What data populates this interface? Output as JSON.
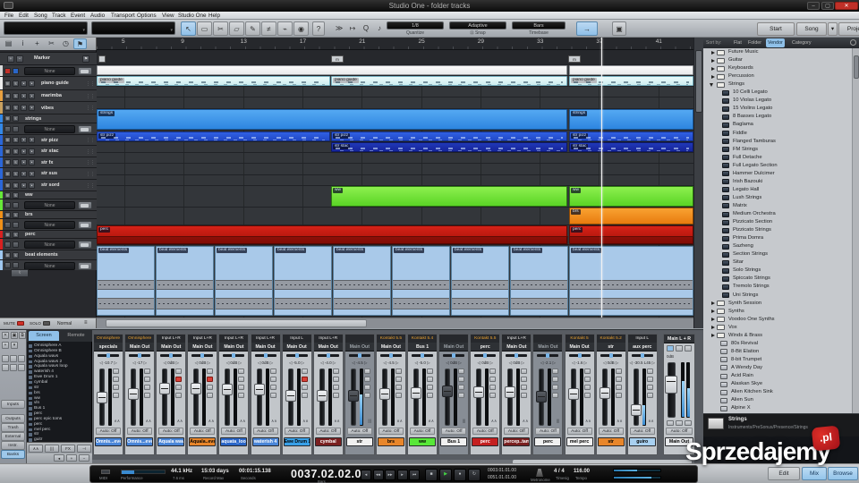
{
  "window": {
    "title": "Studio One - folder tracks"
  },
  "menu": [
    "File",
    "Edit",
    "Song",
    "Track",
    "Event",
    "Audio",
    "Transport",
    "Options",
    "View",
    "Studio One",
    "Help"
  ],
  "toolbar": {
    "help": "?",
    "quantize": {
      "value": "1/8",
      "label": "Quantize"
    },
    "snap": {
      "value": "Adaptive",
      "label": "Snap"
    },
    "timebase": {
      "value": "Bars",
      "label": "Timebase"
    },
    "start": "Start",
    "song": "Song",
    "project": "Project"
  },
  "ruler": {
    "bars": [
      "5",
      "9",
      "13",
      "17",
      "21",
      "25",
      "29",
      "33",
      "37",
      "41"
    ]
  },
  "tracklist": {
    "marker_name": "Marker",
    "bus_none": "None",
    "rows": [
      {
        "type": "group",
        "name": "",
        "color": "#d8d8d8"
      },
      {
        "type": "track",
        "name": "piano guide",
        "color": "#ececec"
      },
      {
        "type": "track",
        "name": "marimba",
        "color": "#e8a040"
      },
      {
        "type": "track",
        "name": "vibes",
        "color": "#c8a060"
      },
      {
        "type": "hdr",
        "name": "strings",
        "color": "#3388e8"
      },
      {
        "type": "none",
        "name": "",
        "color": "#3388e8"
      },
      {
        "type": "track",
        "name": "str pizz",
        "color": "#2a66d8"
      },
      {
        "type": "track",
        "name": "str stac",
        "color": "#2a66d8"
      },
      {
        "type": "track",
        "name": "str fx",
        "color": "#2a66d8"
      },
      {
        "type": "track",
        "name": "str sus",
        "color": "#2a66d8"
      },
      {
        "type": "track",
        "name": "str sord",
        "color": "#2a66d8"
      },
      {
        "type": "hdr",
        "name": "ww",
        "color": "#66e838"
      },
      {
        "type": "none",
        "name": "",
        "color": "#66e838"
      },
      {
        "type": "hdr",
        "name": "brs",
        "color": "#f09018"
      },
      {
        "type": "none",
        "name": "",
        "color": "#f09018"
      },
      {
        "type": "hdr",
        "name": "perc",
        "color": "#d82020"
      },
      {
        "type": "none",
        "name": "",
        "color": "#d82020"
      },
      {
        "type": "hdr",
        "name": "beat elements",
        "color": "#a0c8f0"
      },
      {
        "type": "none",
        "name": "",
        "color": "#a0c8f0"
      }
    ],
    "bottom": {
      "mute": "MUTE",
      "solo": "SOLO",
      "mode": "Normal"
    }
  },
  "arrange": {
    "markers": [
      {
        "label": "",
        "pos": 2
      },
      {
        "label": "m",
        "pos": 262
      },
      {
        "label": "m",
        "pos": 527
      }
    ],
    "rows": [
      {
        "track": "folder overview",
        "clips": [
          {
            "pos": 0,
            "len": 526,
            "color": "white"
          },
          {
            "pos": 528,
            "len": 139,
            "color": "white"
          }
        ]
      },
      {
        "track": "piano guide",
        "clips": [
          {
            "pos": 0,
            "len": 261,
            "color": "cyan",
            "label": "piano guide",
            "notes": true
          },
          {
            "pos": 262,
            "len": 264,
            "color": "cyan",
            "label": "piano guide",
            "notes": true
          },
          {
            "pos": 528,
            "len": 139,
            "color": "cyan",
            "label": "piano guide",
            "notes": true
          }
        ]
      },
      {
        "track": "marimba",
        "clips": []
      },
      {
        "track": "vibes",
        "clips": []
      },
      {
        "track": "strings",
        "clips": [
          {
            "pos": 0,
            "len": 526,
            "color": "blue",
            "label": "strings"
          },
          {
            "pos": 528,
            "len": 139,
            "color": "blue",
            "label": "strings"
          }
        ]
      },
      {
        "track": "str pizz",
        "clips": [
          {
            "pos": 0,
            "len": 261,
            "color": "mblue",
            "label": "str pizz",
            "notes": true
          },
          {
            "pos": 262,
            "len": 264,
            "color": "mblue",
            "label": "str pizz",
            "notes": true
          },
          {
            "pos": 528,
            "len": 139,
            "color": "mblue",
            "label": "str pizz",
            "notes": true
          }
        ]
      },
      {
        "track": "str stac",
        "clips": [
          {
            "pos": 262,
            "len": 264,
            "color": "dblue",
            "label": "str stac",
            "notes": true
          },
          {
            "pos": 528,
            "len": 139,
            "color": "dblue",
            "label": "str stac",
            "notes": true
          }
        ]
      },
      {
        "track": "str fx",
        "clips": []
      },
      {
        "track": "str sus",
        "clips": []
      },
      {
        "track": "str sord",
        "clips": []
      },
      {
        "track": "ww",
        "clips": [
          {
            "pos": 262,
            "len": 264,
            "color": "green",
            "label": "ww"
          },
          {
            "pos": 528,
            "len": 139,
            "color": "green",
            "label": "ww"
          }
        ]
      },
      {
        "track": "brs",
        "clips": [
          {
            "pos": 528,
            "len": 139,
            "color": "orange",
            "label": "brs"
          }
        ]
      },
      {
        "track": "perc",
        "clips": [
          {
            "pos": 0,
            "len": 526,
            "color": "red",
            "label": "perc"
          },
          {
            "pos": 528,
            "len": 139,
            "color": "red",
            "label": "perc"
          }
        ]
      },
      {
        "track": "beat elements",
        "beat": true,
        "clips": [
          {
            "pos": 0,
            "len": 65,
            "color": "beat",
            "label": "beat elements"
          },
          {
            "pos": 66,
            "len": 65,
            "color": "beat",
            "label": "beat elements"
          },
          {
            "pos": 132,
            "len": 65,
            "color": "beat",
            "label": "beat elements"
          },
          {
            "pos": 198,
            "len": 65,
            "color": "beat",
            "label": "beat elements"
          },
          {
            "pos": 264,
            "len": 65,
            "color": "beat",
            "label": "beat elements"
          },
          {
            "pos": 330,
            "len": 65,
            "color": "beat",
            "label": "beat elements"
          },
          {
            "pos": 396,
            "len": 65,
            "color": "beat",
            "label": "beat elements"
          },
          {
            "pos": 462,
            "len": 65,
            "color": "beat",
            "label": "beat elements"
          },
          {
            "pos": 528,
            "len": 139,
            "color": "beat",
            "label": "beat elements"
          }
        ]
      }
    ]
  },
  "browser": {
    "sort_by": "Sort by:",
    "tabs": [
      "Flat",
      "Folder",
      "Vendor",
      "Category"
    ],
    "active_tab": "Vendor",
    "items": [
      {
        "kind": "folder",
        "label": "Future Music"
      },
      {
        "kind": "folder",
        "label": "Guitar"
      },
      {
        "kind": "folder",
        "label": "Keyboards"
      },
      {
        "kind": "folder",
        "label": "Percussion"
      },
      {
        "kind": "folder-open",
        "label": "Strings"
      },
      {
        "kind": "inst",
        "label": "10 Celli Legato"
      },
      {
        "kind": "inst",
        "label": "10 Violas Legato"
      },
      {
        "kind": "inst",
        "label": "15 Violins Legato"
      },
      {
        "kind": "inst",
        "label": "8 Basses Legato"
      },
      {
        "kind": "inst",
        "label": "Baglama"
      },
      {
        "kind": "inst",
        "label": "Fiddle"
      },
      {
        "kind": "inst",
        "label": "Flanged Tamburas"
      },
      {
        "kind": "inst",
        "label": "FM Strings"
      },
      {
        "kind": "inst",
        "label": "Full Detache"
      },
      {
        "kind": "inst",
        "label": "Full Legato Section"
      },
      {
        "kind": "inst",
        "label": "Hammer Dulcimer"
      },
      {
        "kind": "inst",
        "label": "Irish Bazouki"
      },
      {
        "kind": "inst",
        "label": "Legato Hall"
      },
      {
        "kind": "inst",
        "label": "Lush Strings"
      },
      {
        "kind": "inst",
        "label": "Matrix"
      },
      {
        "kind": "inst",
        "label": "Medium Orchestra"
      },
      {
        "kind": "inst",
        "label": "Pizzicato Section"
      },
      {
        "kind": "inst",
        "label": "Pizzicato Strings"
      },
      {
        "kind": "inst",
        "label": "Prima Domra"
      },
      {
        "kind": "inst",
        "label": "Sazheng"
      },
      {
        "kind": "inst",
        "label": "Section Strings"
      },
      {
        "kind": "inst",
        "label": "Sitar"
      },
      {
        "kind": "inst",
        "label": "Solo Strings"
      },
      {
        "kind": "inst",
        "label": "Spiccato Strings"
      },
      {
        "kind": "inst",
        "label": "Tremolo Strings"
      },
      {
        "kind": "inst",
        "label": "Uni Strings"
      },
      {
        "kind": "folder",
        "label": "Synth Session"
      },
      {
        "kind": "folder",
        "label": "Synths"
      },
      {
        "kind": "folder",
        "label": "Voodoo One Synths"
      },
      {
        "kind": "folder",
        "label": "Vox"
      },
      {
        "kind": "folder",
        "label": "Winds & Brass"
      },
      {
        "kind": "preset",
        "label": "80s Revival"
      },
      {
        "kind": "preset",
        "label": "8-Bit Elation"
      },
      {
        "kind": "preset",
        "label": "8-bit Trumpet"
      },
      {
        "kind": "preset",
        "label": "A Wendy Day"
      },
      {
        "kind": "preset",
        "label": "Acid Rain"
      },
      {
        "kind": "preset",
        "label": "Alaskan Skye"
      },
      {
        "kind": "preset",
        "label": "Alien Kitchen Sink"
      },
      {
        "kind": "preset",
        "label": "Alien Sun"
      },
      {
        "kind": "preset",
        "label": "Alpine X"
      }
    ],
    "info": {
      "title": "Strings",
      "path": "Instruments/PreSonus/Presence/Strings"
    }
  },
  "mixer": {
    "tabs": [
      "Screen",
      "Remote"
    ],
    "active_tab": "Screen",
    "side_buttons": [
      "Inputs",
      "Outputs",
      "Trash",
      "External",
      "Instr.",
      "Banks"
    ],
    "active_side": "Banks",
    "channels": [
      "Omnisphere A",
      "Omnisphere B",
      "Aquala wavs",
      "Aquala wavs 2",
      "Aquala wavs loop",
      "waterish 4",
      "Ewe Drum 1",
      "cymbal",
      "str",
      "brs",
      "ww",
      "vln",
      "Bus 1",
      "perc",
      "perc epic toms",
      "perc",
      "mel perc",
      "str",
      "guitr"
    ],
    "auto_label": "Auto: Off",
    "strips": [
      {
        "instr": "Omnisphere",
        "plug": true,
        "out": "specials",
        "val": "-10.7",
        "name": "Omnis...eveA",
        "bg": "#4a86d8",
        "fg": "#ffffff",
        "fader": 0.5
      },
      {
        "instr": "Omnisphere",
        "plug": true,
        "out": "Main Out",
        "val": "-17",
        "name": "Omnis...eveB",
        "bg": "#4a86d8",
        "fg": "#ffffff",
        "fader": 0.42
      },
      {
        "instr": "Input L+R",
        "out": "Main Out",
        "val": "0dB",
        "name": "Aquala wavs",
        "bg": "#4a86d8",
        "fg": "#ffffff",
        "fader": 0.3,
        "armed": true
      },
      {
        "instr": "Input L+R",
        "out": "Main Out",
        "val": "0dB",
        "name": "Aquala..evs2",
        "bg": "#e8862a",
        "fg": "#000000",
        "fader": 0.3,
        "armed": true
      },
      {
        "instr": "Input L+R",
        "out": "Main Out",
        "val": "0dB",
        "name": "aquata_loop",
        "bg": "#2a66c8",
        "fg": "#ffffff",
        "fader": 0.32
      },
      {
        "instr": "Input L+R",
        "out": "Main Out",
        "val": "0dB",
        "name": "waterish 4",
        "bg": "#4a86d8",
        "fg": "#ffffff",
        "fader": 0.32
      },
      {
        "instr": "Input L",
        "out": "Main Out",
        "val": "-5.0",
        "name": "Ewe Drum 1",
        "bg": "#38a0e8",
        "fg": "#000000",
        "fader": 0.45,
        "armed": true
      },
      {
        "instr": "Input L+R",
        "out": "Main Out",
        "val": "-4.0",
        "name": "cymbal",
        "bg": "#7a2020",
        "fg": "#ffffff",
        "fader": 0.45
      },
      {
        "instr": "",
        "out": "Main Out",
        "val": "-4.5",
        "name": "str",
        "bg": "#f0f0f0",
        "fg": "#000000",
        "fader": 0.45,
        "dark": true,
        "meter": 0.55
      },
      {
        "instr": "Kontakt 5.5",
        "plug": true,
        "out": "Main Out",
        "val": "-4.5",
        "name": "brs",
        "bg": "#e8862a",
        "fg": "#000000",
        "fader": 0.42
      },
      {
        "instr": "Kontakt 5.4",
        "plug": true,
        "out": "Bus 1",
        "val": "-5.0",
        "name": "ww",
        "bg": "#58e838",
        "fg": "#000000",
        "fader": 0.4
      },
      {
        "instr": "",
        "out": "Main Out",
        "val": "0dB",
        "name": "Bus 1",
        "bg": "#f0f0f0",
        "fg": "#000000",
        "fader": 0.35,
        "dark": true
      },
      {
        "instr": "Kontakt 5.5",
        "plug": true,
        "out": "perc",
        "val": "0dB",
        "name": "perc",
        "bg": "#c42020",
        "fg": "#ffffff",
        "fader": 0.38
      },
      {
        "instr": "Input L+R",
        "out": "Main Out",
        "val": "0dB",
        "name": "percep..tams",
        "bg": "#7a2020",
        "fg": "#ffffff",
        "fader": 0.38
      },
      {
        "instr": "",
        "out": "Main Out",
        "val": "-2.1",
        "name": "perc",
        "bg": "#f0f0f0",
        "fg": "#000000",
        "fader": 0.48,
        "dark": true
      },
      {
        "instr": "Kontakt 5",
        "plug": true,
        "out": "Main Out",
        "val": "-1.6",
        "name": "mel perc",
        "bg": "#f0f0f0",
        "fg": "#000000",
        "fader": 0.42
      },
      {
        "instr": "Kontakt 5.2",
        "plug": true,
        "out": "str",
        "val": "0dB",
        "name": "str",
        "bg": "#e8862a",
        "fg": "#000000",
        "fader": 0.4
      },
      {
        "instr": "Input L",
        "out": "aux perc",
        "val": "-30.5  L45",
        "name": "guiro",
        "bg": "#a8d0f0",
        "fg": "#000000",
        "fader": 0.78,
        "meter": 0.35
      }
    ],
    "master": {
      "title": "Main L + R",
      "val": "0dB",
      "name": "Main Out",
      "fader": 0.35
    }
  },
  "transport": {
    "midi": "MIDI",
    "performance": "Performance",
    "sample_rate": "44.1 kHz",
    "latency": "7.6 ms",
    "record_max": "15:03 days",
    "record_max_label": "Record Max",
    "seconds": "00:01:15.138",
    "seconds_label": "Seconds",
    "position": "0037.02.02.06",
    "position_label": "Bars",
    "loop_start": "0003.01.01.00",
    "loop_end": "0051.01.01.00",
    "metronome_label": "Metronome",
    "timesig": "4 / 4",
    "timesig_label": "Timesig",
    "tempo": "116.00",
    "tempo_label": "Tempo"
  },
  "view_buttons": {
    "edit": "Edit",
    "mix": "Mix",
    "browse": "Browse"
  },
  "watermark": {
    "text": "Sprzedajemy",
    "badge": ".pl"
  }
}
